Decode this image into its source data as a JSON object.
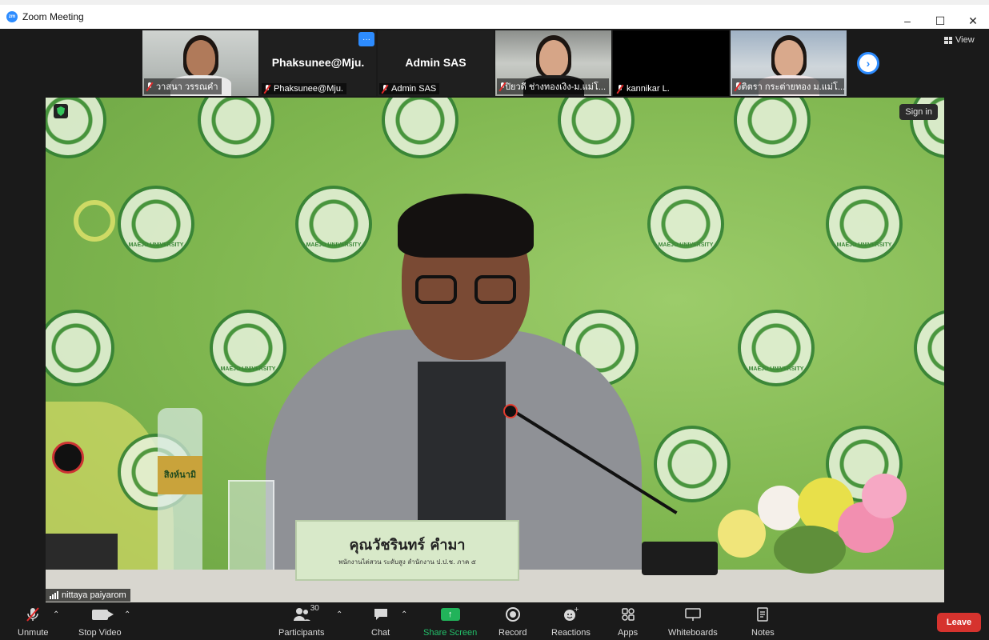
{
  "window": {
    "app_icon": "zoom-logo-icon",
    "title": "Zoom Meeting"
  },
  "window_controls": {
    "minimize": "–",
    "maximize": "☐",
    "close": "✕"
  },
  "participants_strip": [
    {
      "name": "วาสนา วรรณคำ",
      "type": "video",
      "muted": true
    },
    {
      "name": "Phaksunee@Mju.",
      "display_name": "Phaksunee@Mju.",
      "type": "avatar",
      "muted": true,
      "more": "···"
    },
    {
      "name": "Admin SAS",
      "display_name": "Admin SAS",
      "type": "avatar",
      "muted": true
    },
    {
      "name": "ปิยวดี ช่างทองเงิง-ม.แม่โ...",
      "type": "video",
      "muted": true
    },
    {
      "name": "kannikar L.",
      "type": "dark",
      "muted": true
    },
    {
      "name": "จิติตรา กระต่ายทอง ม.แม่โ...",
      "type": "video",
      "muted": true
    }
  ],
  "strip_next": "›",
  "view": {
    "label": "View"
  },
  "main": {
    "sign_in": "Sign in",
    "nameplate_name": "คุณวัชรินทร์ คำมา",
    "nameplate_title": "พนักงานไต่สวน ระดับสูง สำนักงาน ป.ป.ช. ภาค ๕",
    "seal_text": "MAEJO UNIVERSITY",
    "bottle_label": "สิงห์นามิ",
    "speaker_name": "nittaya paiyarom"
  },
  "toolbar": {
    "unmute": "Unmute",
    "stop_video": "Stop Video",
    "participants": "Participants",
    "participants_count": "30",
    "chat": "Chat",
    "share_screen": "Share Screen",
    "record": "Record",
    "reactions": "Reactions",
    "apps": "Apps",
    "whiteboards": "Whiteboards",
    "notes": "Notes",
    "leave": "Leave"
  },
  "colors": {
    "accent": "#2d8cff",
    "share_green": "#22b35a",
    "leave_red": "#d6332e",
    "background": "#1a1a1a"
  }
}
